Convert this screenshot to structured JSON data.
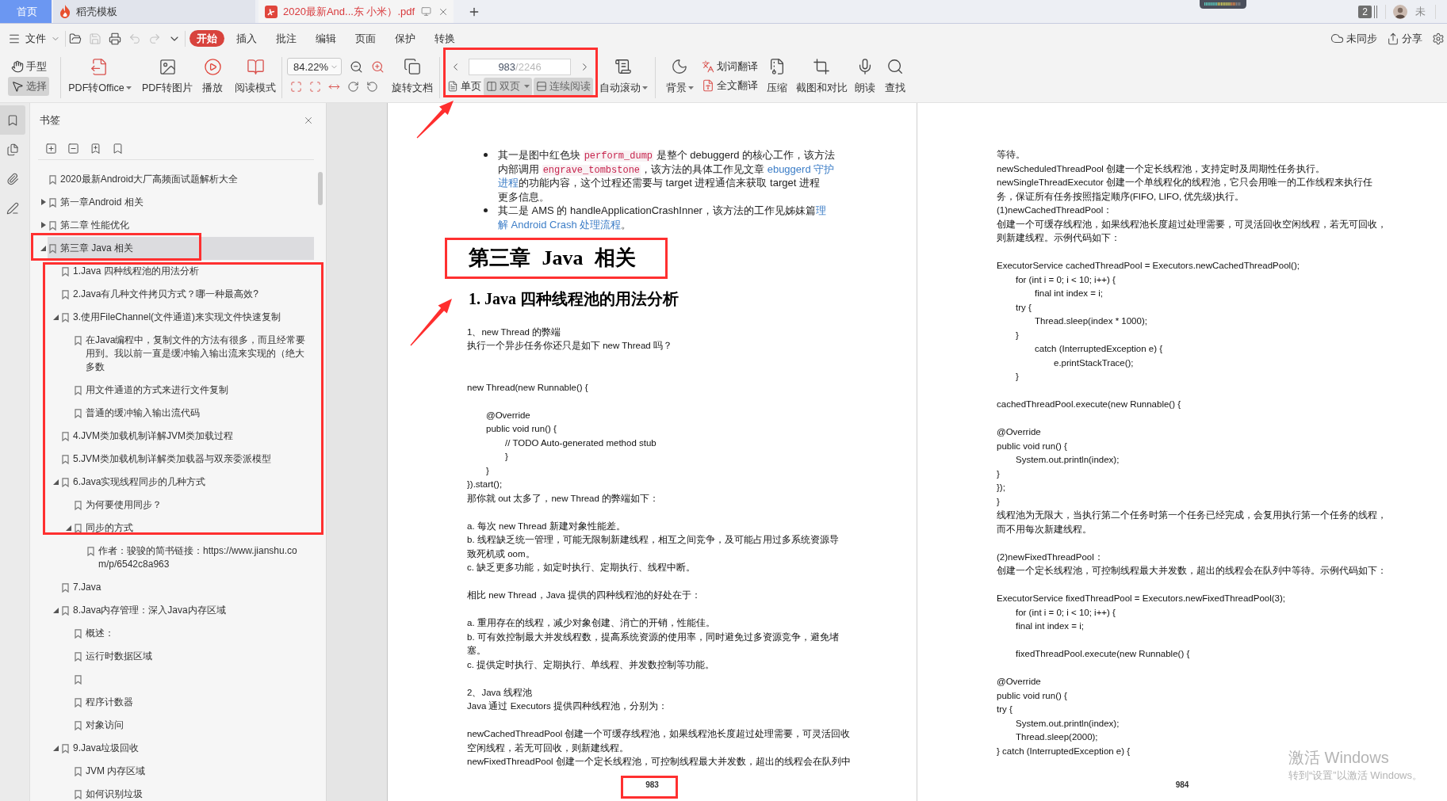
{
  "tab_bar": {
    "tabs": [
      {
        "kind": "home",
        "label": "首页",
        "selected": false
      },
      {
        "kind": "templates",
        "label": "稻壳模板",
        "selected": false
      },
      {
        "kind": "document",
        "label": "2020最新And...东 小米）.pdf",
        "selected": true
      }
    ],
    "badge": "2",
    "user_name": "未"
  },
  "menu_bar": {
    "file_label": "文件",
    "quick_actions": [
      {
        "kind": "open",
        "disabled": false
      },
      {
        "kind": "save",
        "disabled": true
      },
      {
        "kind": "print",
        "disabled": false
      },
      {
        "kind": "undo",
        "disabled": true
      },
      {
        "kind": "redo",
        "disabled": true
      },
      {
        "kind": "more",
        "disabled": false
      }
    ],
    "ribbon_tabs": [
      {
        "label": "开始",
        "selected": true
      },
      {
        "label": "插入",
        "selected": false
      },
      {
        "label": "批注",
        "selected": false
      },
      {
        "label": "编辑",
        "selected": false
      },
      {
        "label": "页面",
        "selected": false
      },
      {
        "label": "保护",
        "selected": false
      },
      {
        "label": "转换",
        "selected": false
      }
    ],
    "sync_label": "未同步",
    "share_label": "分享"
  },
  "toolbar": {
    "modes": [
      {
        "kind": "hand",
        "label": "手型",
        "selected": false
      },
      {
        "kind": "select",
        "label": "选择",
        "selected": true
      }
    ],
    "convert_buttons": [
      {
        "kind": "pdf_to_office",
        "label": "PDF转Office",
        "dropdown": true
      },
      {
        "kind": "pdf_to_image",
        "label": "PDF转图片",
        "dropdown": false
      },
      {
        "kind": "play",
        "label": "播放",
        "dropdown": false
      },
      {
        "kind": "reading_mode",
        "label": "阅读模式",
        "dropdown": false
      }
    ],
    "zoom_value": "84.22%",
    "rotate_label": "旋转文档",
    "page_field": {
      "value": "983",
      "total": "/2246"
    },
    "view_modes": [
      {
        "kind": "single",
        "label": "单页",
        "selected": false,
        "dropdown": false
      },
      {
        "kind": "double",
        "label": "双页",
        "selected": true,
        "dropdown": true
      },
      {
        "kind": "continuous",
        "label": "连续阅读",
        "selected": true,
        "dropdown": false
      }
    ],
    "auto_scroll_label": "自动滚动",
    "background_label": "背景",
    "translate": [
      {
        "kind": "word",
        "label": "划词翻译"
      },
      {
        "kind": "full",
        "label": "全文翻译"
      }
    ],
    "tools": [
      {
        "kind": "compress",
        "label": "压缩"
      },
      {
        "kind": "screenshot_compare",
        "label": "截图和对比"
      },
      {
        "kind": "read_aloud",
        "label": "朗读"
      },
      {
        "kind": "find",
        "label": "查找"
      }
    ]
  },
  "sidebar": {
    "rail": [
      {
        "kind": "bookmarks",
        "selected": true
      },
      {
        "kind": "thumbnails",
        "selected": false
      },
      {
        "kind": "attachments",
        "selected": false
      },
      {
        "kind": "signatures",
        "selected": false
      }
    ],
    "title": "书签",
    "tree": [
      {
        "label": "2020最新Android大厂高频面试题解析大全",
        "selected": false
      },
      {
        "label": "第一章Android 相关",
        "selected": false,
        "expanded": false
      },
      {
        "label": "第二章 性能优化",
        "selected": false,
        "expanded": false
      },
      {
        "label": "第三章 Java 相关",
        "selected": true,
        "expanded": true,
        "children": [
          {
            "label": "1.Java 四种线程池的用法分析",
            "selected": false
          },
          {
            "label": "2.Java有几种文件拷贝方式？哪一种最高效?",
            "selected": false
          },
          {
            "label": "3.使用FileChannel(文件通道)来实现文件快速复制",
            "selected": false,
            "expanded": true,
            "children": [
              {
                "label": "在Java编程中，复制文件的方法有很多，而且经常要用到。我以前一直是缓冲输入输出流来实现的（绝大多数",
                "selected": false
              },
              {
                "label": "用文件通道的方式来进行文件复制",
                "selected": false
              },
              {
                "label": "普通的缓冲输入输出流代码",
                "selected": false
              }
            ]
          },
          {
            "label": "4.JVM类加载机制详解JVM类加载过程",
            "selected": false
          },
          {
            "label": "5.JVM类加载机制详解类加载器与双亲委派模型",
            "selected": false
          },
          {
            "label": "6.Java实现线程同步的几种方式",
            "selected": false,
            "expanded": true,
            "children": [
              {
                "label": "为何要使用同步？",
                "selected": false
              },
              {
                "label": "同步的方式",
                "selected": false,
                "expanded": true,
                "children": [
                  {
                    "label": "作者：骏骏的简书链接：https://www.jianshu.com/p/6542c8a963",
                    "selected": false
                  }
                ]
              }
            ]
          },
          {
            "label": "7.Java",
            "selected": false
          },
          {
            "label": "8.Java内存管理：深入Java内存区域",
            "selected": false,
            "expanded": true,
            "children": [
              {
                "label": "概述：",
                "selected": false
              },
              {
                "label": "运行时数据区域",
                "selected": false
              },
              {
                "selected": false
              },
              {
                "label": "程序计数器",
                "selected": false
              },
              {
                "label": "对象访问",
                "selected": false
              }
            ]
          },
          {
            "label": "9.Java垃圾回收",
            "selected": false,
            "expanded": true,
            "children": [
              {
                "label": "JVM 内存区域",
                "selected": false
              },
              {
                "label": "如何识别垃圾",
                "selected": false
              }
            ]
          }
        ]
      }
    ]
  },
  "document": {
    "pages": [
      {
        "page_number": "983",
        "blocks": [
          {
            "kind": "bullet",
            "lines": [
              [
                {
                  "kind": "text",
                  "text": "其一是图中红色块 "
                },
                {
                  "kind": "code",
                  "text": "perform_dump"
                },
                {
                  "kind": "text",
                  "text": " 是整个 debuggerd 的核心工作，该方法"
                }
              ],
              [
                {
                  "kind": "text",
                  "text": "内部调用 "
                },
                {
                  "kind": "code",
                  "text": "engrave_tombstone"
                },
                {
                  "kind": "text",
                  "text": "，该方法的具体工作见文章 "
                },
                {
                  "kind": "link",
                  "text": "ebuggerd 守护"
                }
              ],
              [
                {
                  "kind": "link",
                  "text": "进程"
                },
                {
                  "kind": "text",
                  "text": "的功能内容，这个过程还需要与 target 进程通信来获取 target 进程"
                }
              ],
              [
                {
                  "kind": "text",
                  "text": "更多信息。"
                }
              ]
            ]
          },
          {
            "kind": "bullet",
            "lines": [
              [
                {
                  "kind": "text",
                  "text": "其二是 AMS 的 handleApplicationCrashInner，该方法的工作见姊妹篇"
                },
                {
                  "kind": "link",
                  "text": "理"
                }
              ],
              [
                {
                  "kind": "link",
                  "text": "解 Android Crash 处理流程"
                },
                {
                  "kind": "text",
                  "text": "。"
                }
              ]
            ]
          },
          {
            "kind": "chapter_heading",
            "text": "第三章 Java 相关"
          },
          {
            "kind": "section_heading",
            "text": "1. Java 四种线程池的用法分析"
          },
          {
            "kind": "paragraph",
            "lines": [
              "1、new Thread 的弊端"
            ]
          },
          {
            "kind": "paragraph",
            "lines": [
              "执行一个异步任务你还只是如下 new Thread 吗？"
            ]
          },
          {
            "kind": "blank"
          },
          {
            "kind": "blank"
          },
          {
            "kind": "code",
            "text": "new Thread(new Runnable() {"
          },
          {
            "kind": "blank"
          },
          {
            "kind": "code",
            "text": "\t@Override"
          },
          {
            "kind": "code",
            "text": "\tpublic void run() {"
          },
          {
            "kind": "code",
            "text": "\t\t// TODO Auto-generated method stub"
          },
          {
            "kind": "code",
            "text": "\t\t}"
          },
          {
            "kind": "code",
            "text": "\t}"
          },
          {
            "kind": "code",
            "text": "}).start();"
          },
          {
            "kind": "paragraph",
            "lines": [
              "那你就 out 太多了，new Thread 的弊端如下："
            ]
          },
          {
            "kind": "blank"
          },
          {
            "kind": "paragraph",
            "lines": [
              "a. 每次 new Thread 新建对象性能差。"
            ]
          },
          {
            "kind": "paragraph",
            "lines": [
              "b. 线程缺乏统一管理，可能无限制新建线程，相互之间竞争，及可能占用过多系统资源导",
              "致死机或 oom。"
            ]
          },
          {
            "kind": "paragraph",
            "lines": [
              "c. 缺乏更多功能，如定时执行、定期执行、线程中断。"
            ]
          },
          {
            "kind": "blank"
          },
          {
            "kind": "paragraph",
            "lines": [
              "相比 new Thread，Java 提供的四种线程池的好处在于："
            ]
          },
          {
            "kind": "blank"
          },
          {
            "kind": "paragraph",
            "lines": [
              "a. 重用存在的线程，减少对象创建、消亡的开销，性能佳。"
            ]
          },
          {
            "kind": "paragraph",
            "lines": [
              "b. 可有效控制最大并发线程数，提高系统资源的使用率，同时避免过多资源竞争，避免堵",
              "塞。"
            ]
          },
          {
            "kind": "paragraph",
            "lines": [
              "c. 提供定时执行、定期执行、单线程、并发数控制等功能。"
            ]
          },
          {
            "kind": "blank"
          },
          {
            "kind": "paragraph",
            "lines": [
              "2、Java 线程池"
            ]
          },
          {
            "kind": "paragraph",
            "lines": [
              "Java 通过 Executors 提供四种线程池，分别为："
            ]
          },
          {
            "kind": "blank"
          },
          {
            "kind": "paragraph",
            "lines": [
              "newCachedThreadPool 创建一个可缓存线程池，如果线程池长度超过处理需要，可灵活回收",
              "空闲线程，若无可回收，则新建线程。"
            ]
          },
          {
            "kind": "paragraph",
            "lines": [
              "newFixedThreadPool 创建一个定长线程池，可控制线程最大并发数，超出的线程会在队列中"
            ]
          }
        ]
      },
      {
        "page_number": "984",
        "blocks": [
          {
            "kind": "paragraph",
            "lines": [
              "等待。"
            ]
          },
          {
            "kind": "paragraph",
            "lines": [
              "newScheduledThreadPool 创建一个定长线程池，支持定时及周期性任务执行。"
            ]
          },
          {
            "kind": "paragraph",
            "lines": [
              "newSingleThreadExecutor 创建一个单线程化的线程池，它只会用唯一的工作线程来执行任",
              "务，保证所有任务按照指定顺序(FIFO, LIFO, 优先级)执行。"
            ]
          },
          {
            "kind": "paragraph",
            "lines": [
              "(1)newCachedThreadPool："
            ]
          },
          {
            "kind": "paragraph",
            "lines": [
              "创建一个可缓存线程池，如果线程池长度超过处理需要，可灵活回收空闲线程，若无可回收，",
              "则新建线程。示例代码如下："
            ]
          },
          {
            "kind": "blank"
          },
          {
            "kind": "code",
            "text": "ExecutorService cachedThreadPool = Executors.newCachedThreadPool();"
          },
          {
            "kind": "code",
            "text": "\tfor (int i = 0; i < 10; i++) {"
          },
          {
            "kind": "code",
            "text": "\t\tfinal int index = i;"
          },
          {
            "kind": "code",
            "text": "\ttry {"
          },
          {
            "kind": "code",
            "text": "\t\tThread.sleep(index * 1000);"
          },
          {
            "kind": "code",
            "text": "\t}"
          },
          {
            "kind": "code",
            "text": "\t\tcatch (InterruptedException e) {"
          },
          {
            "kind": "code",
            "text": "\t\t\te.printStackTrace();"
          },
          {
            "kind": "code",
            "text": "\t}"
          },
          {
            "kind": "blank"
          },
          {
            "kind": "code",
            "text": "cachedThreadPool.execute(new Runnable() {"
          },
          {
            "kind": "blank"
          },
          {
            "kind": "code",
            "text": "@Override"
          },
          {
            "kind": "code",
            "text": "public void run() {"
          },
          {
            "kind": "code",
            "text": "\tSystem.out.println(index);"
          },
          {
            "kind": "code",
            "text": "}"
          },
          {
            "kind": "code",
            "text": "});"
          },
          {
            "kind": "code",
            "text": "}"
          },
          {
            "kind": "paragraph",
            "lines": [
              "线程池为无限大，当执行第二个任务时第一个任务已经完成，会复用执行第一个任务的线程，",
              "而不用每次新建线程。"
            ]
          },
          {
            "kind": "blank"
          },
          {
            "kind": "paragraph",
            "lines": [
              "(2)newFixedThreadPool："
            ]
          },
          {
            "kind": "paragraph",
            "lines": [
              "创建一个定长线程池，可控制线程最大并发数，超出的线程会在队列中等待。示例代码如下："
            ]
          },
          {
            "kind": "blank"
          },
          {
            "kind": "code",
            "text": "ExecutorService fixedThreadPool = Executors.newFixedThreadPool(3);"
          },
          {
            "kind": "code",
            "text": "\tfor (int i = 0; i < 10; i++) {"
          },
          {
            "kind": "code",
            "text": "\tfinal int index = i;"
          },
          {
            "kind": "blank"
          },
          {
            "kind": "code",
            "text": "\tfixedThreadPool.execute(new Runnable() {"
          },
          {
            "kind": "blank"
          },
          {
            "kind": "code",
            "text": "@Override"
          },
          {
            "kind": "code",
            "text": "public void run() {"
          },
          {
            "kind": "code",
            "text": "try {"
          },
          {
            "kind": "code",
            "text": "\tSystem.out.println(index);"
          },
          {
            "kind": "code",
            "text": "\tThread.sleep(2000);"
          },
          {
            "kind": "code",
            "text": "} catch (InterruptedException e) {"
          }
        ]
      }
    ]
  },
  "annotations": [
    {
      "kind": "frame"
    },
    {
      "kind": "frame"
    },
    {
      "kind": "frame"
    },
    {
      "kind": "frame"
    },
    {
      "kind": "frame"
    },
    {
      "kind": "arrow"
    },
    {
      "kind": "arrow"
    }
  ],
  "os_notice": {
    "title": "激活 Windows",
    "message": "转到“设置”以激活 Windows。"
  }
}
